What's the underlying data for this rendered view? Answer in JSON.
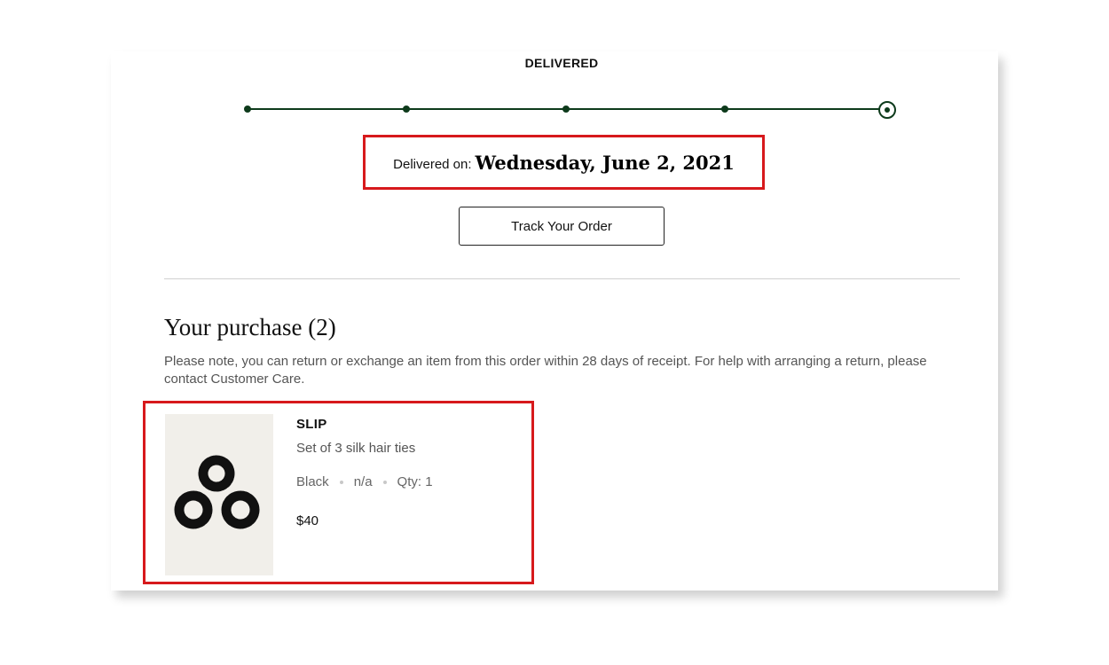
{
  "status": {
    "title": "DELIVERED",
    "delivered_label": "Delivered on:",
    "delivered_date": "Wednesday, June 2, 2021",
    "track_button_label": "Track Your Order"
  },
  "purchase": {
    "title": "Your purchase (2)",
    "note": "Please note, you can return or exchange an item from this order within 28 days of receipt. For help with arranging a return, please contact Customer Care."
  },
  "items": [
    {
      "brand": "SLIP",
      "description": "Set of 3 silk hair ties",
      "color": "Black",
      "size": "n/a",
      "qty": "Qty: 1",
      "price": "$40",
      "image_icon": "hair-ties-image"
    }
  ],
  "colors": {
    "accent": "#0d3a1b",
    "highlight": "#d7191c"
  }
}
